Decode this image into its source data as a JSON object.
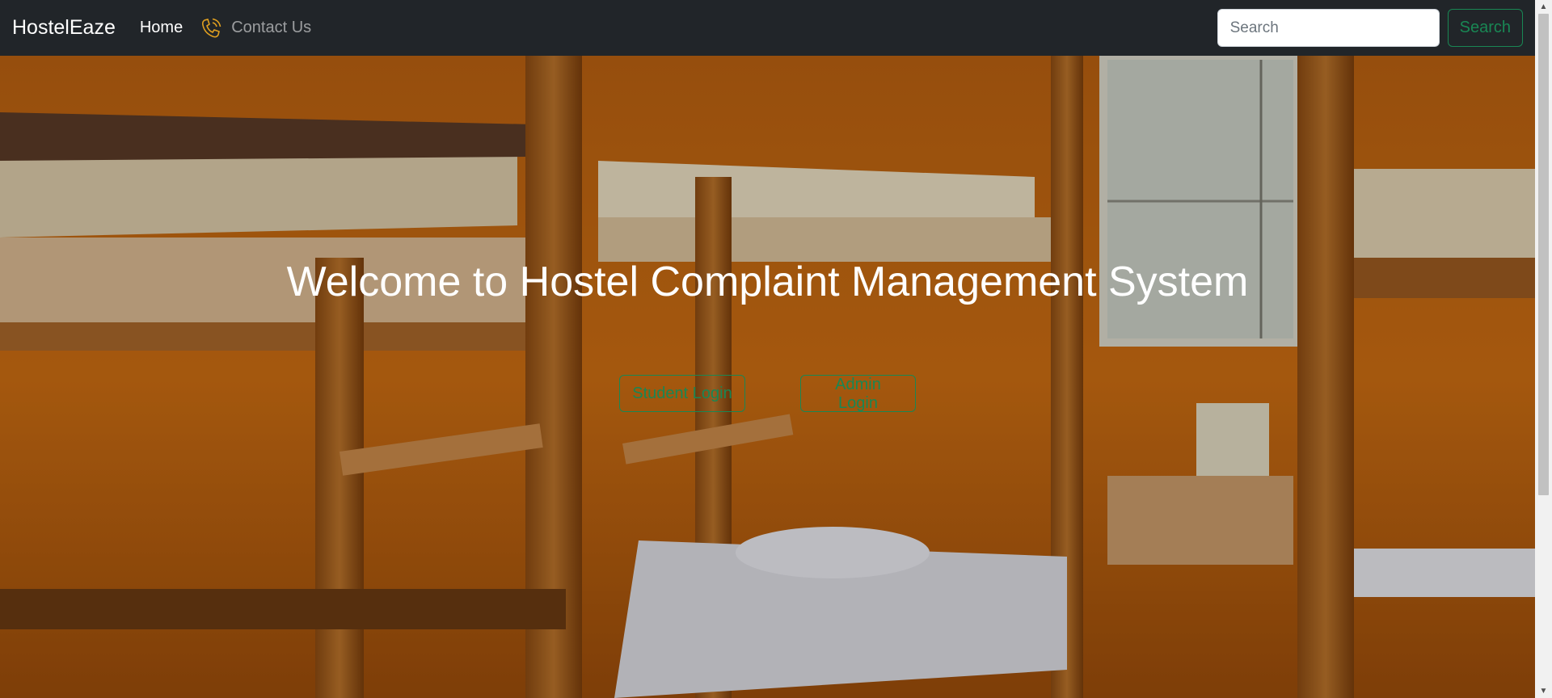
{
  "navbar": {
    "brand": "HostelEaze",
    "links": [
      {
        "label": "Home"
      },
      {
        "label": "Contact Us",
        "icon": "phone-icon"
      }
    ],
    "search": {
      "placeholder": "Search",
      "value": "",
      "button_label": "Search"
    }
  },
  "hero": {
    "title": "Welcome to Hostel Complaint Management System",
    "buttons": [
      {
        "label": "Student Login"
      },
      {
        "label": "Admin Login"
      }
    ]
  },
  "colors": {
    "navbar_bg": "#212529",
    "accent_green": "#198754",
    "phone_icon": "#e0a020"
  }
}
